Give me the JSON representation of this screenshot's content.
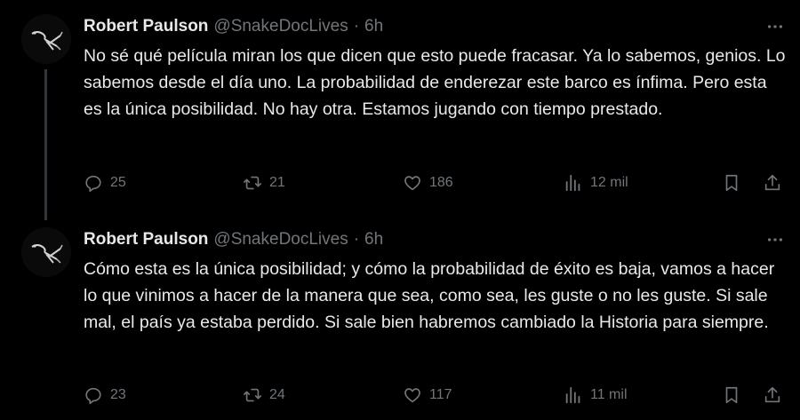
{
  "tweets": [
    {
      "author_name": "Robert Paulson",
      "handle": "@SnakeDocLives",
      "separator": "·",
      "time": "6h",
      "text": "No sé qué película miran los que dicen que esto puede fracasar. Ya lo sabemos, genios. Lo sabemos desde el día uno. La probabilidad de enderezar este barco es ínfima. Pero esta es la única posibilidad. No hay otra. Estamos jugando con tiempo prestado.",
      "replies": "25",
      "reposts": "21",
      "likes": "186",
      "views": "12 mil"
    },
    {
      "author_name": "Robert Paulson",
      "handle": "@SnakeDocLives",
      "separator": "·",
      "time": "6h",
      "text": "Cómo esta es la única posibilidad; y cómo la probabilidad de éxito es baja, vamos a hacer lo que vinimos a hacer de la manera que sea, como sea, les guste o no les guste. Si sale mal, el país ya estaba perdido. Si sale bien habremos cambiado la Historia para siempre.",
      "replies": "23",
      "reposts": "24",
      "likes": "117",
      "views": "11 mil"
    }
  ],
  "icons": {
    "reply": "reply-icon",
    "repost": "repost-icon",
    "like": "like-icon",
    "views": "views-icon",
    "bookmark": "bookmark-icon",
    "share": "share-icon",
    "more": "more-icon"
  },
  "colors": {
    "background": "#000000",
    "text": "#e7e9ea",
    "secondary": "#71767b",
    "thread_line": "#333639"
  }
}
